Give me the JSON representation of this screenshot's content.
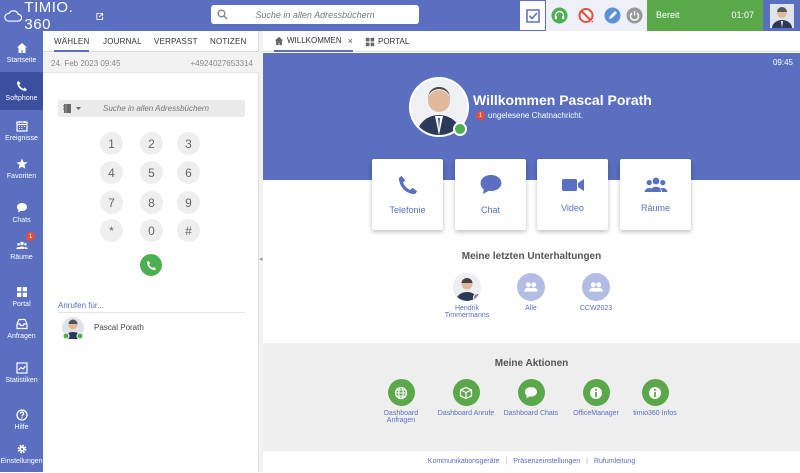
{
  "app": {
    "logo_text": "TIMIO. 360",
    "search_placeholder": "Suche in allen Adressbüchern",
    "status_label": "Bereit",
    "status_time": "01:07"
  },
  "colors": {
    "primary": "#5a6fc0",
    "primary_dark": "#3c4e9e",
    "green": "#5aa84a",
    "red": "#e54c3c"
  },
  "leftnav": {
    "items": [
      {
        "label": "Startseite",
        "icon": "home-icon"
      },
      {
        "label": "Softphone",
        "icon": "phone-icon"
      },
      {
        "label": "Ereignisse",
        "icon": "calendar-icon"
      },
      {
        "label": "Favoriten",
        "icon": "star-icon"
      },
      {
        "label": "Chats",
        "icon": "chat-icon"
      },
      {
        "label": "Räume",
        "icon": "group-icon",
        "badge": "1"
      },
      {
        "label": "Portal",
        "icon": "grid-icon"
      },
      {
        "label": "Anfragen",
        "icon": "inbox-icon"
      },
      {
        "label": "Statistiken",
        "icon": "statistics-icon"
      },
      {
        "label": "Hilfe",
        "icon": "help-icon"
      },
      {
        "label": "Einstellungen",
        "icon": "gear-icon"
      }
    ]
  },
  "phone": {
    "tabs": [
      "WÄHLEN",
      "JOURNAL",
      "VERPASST",
      "NOTIZEN"
    ],
    "last_call_date": "24. Feb 2023   09:45",
    "last_call_number": "+4924027653314",
    "search_placeholder": "Suche in allen Adressbüchern",
    "keys": [
      "1",
      "2",
      "3",
      "4",
      "5",
      "6",
      "7",
      "8",
      "9",
      "*",
      "0",
      "#"
    ],
    "call_for_label": "Anrufen für...",
    "contact_name": "Pascal Porath"
  },
  "main": {
    "tabs": [
      {
        "label": "WILLKOMMEN",
        "close": "×"
      },
      {
        "label": "PORTAL"
      }
    ],
    "time": "09:45",
    "welcome": "Willkommen Pascal Porath",
    "unread_count": "1",
    "unread_text": "ungelesene Chatnachricht.",
    "cards": [
      {
        "label": "Telefonie",
        "icon": "phone-icon"
      },
      {
        "label": "Chat",
        "icon": "chat-bubble-icon"
      },
      {
        "label": "Video",
        "icon": "video-camera-icon"
      },
      {
        "label": "Räume",
        "icon": "group-icon"
      }
    ],
    "conversations_title": "Meine letzten Unterhaltungen",
    "conversations": [
      {
        "label": "Hendrik Timmermanns",
        "type": "photo"
      },
      {
        "label": "Alle",
        "type": "group"
      },
      {
        "label": "CCW2023",
        "type": "group"
      }
    ],
    "actions_title": "Meine Aktionen",
    "actions": [
      {
        "label": "Dashboard Anfragen",
        "icon": "globe-icon"
      },
      {
        "label": "Dashboard Anrufe",
        "icon": "box-icon"
      },
      {
        "label": "Dashboard Chats",
        "icon": "chat-bubble-icon"
      },
      {
        "label": "OfficeManager",
        "icon": "info-icon"
      },
      {
        "label": "timio360 Infos",
        "icon": "info-icon"
      }
    ],
    "footer_links": [
      "Kommunikationsgeräte",
      "Präsenzeinstellungen",
      "Rufumleitung"
    ]
  }
}
